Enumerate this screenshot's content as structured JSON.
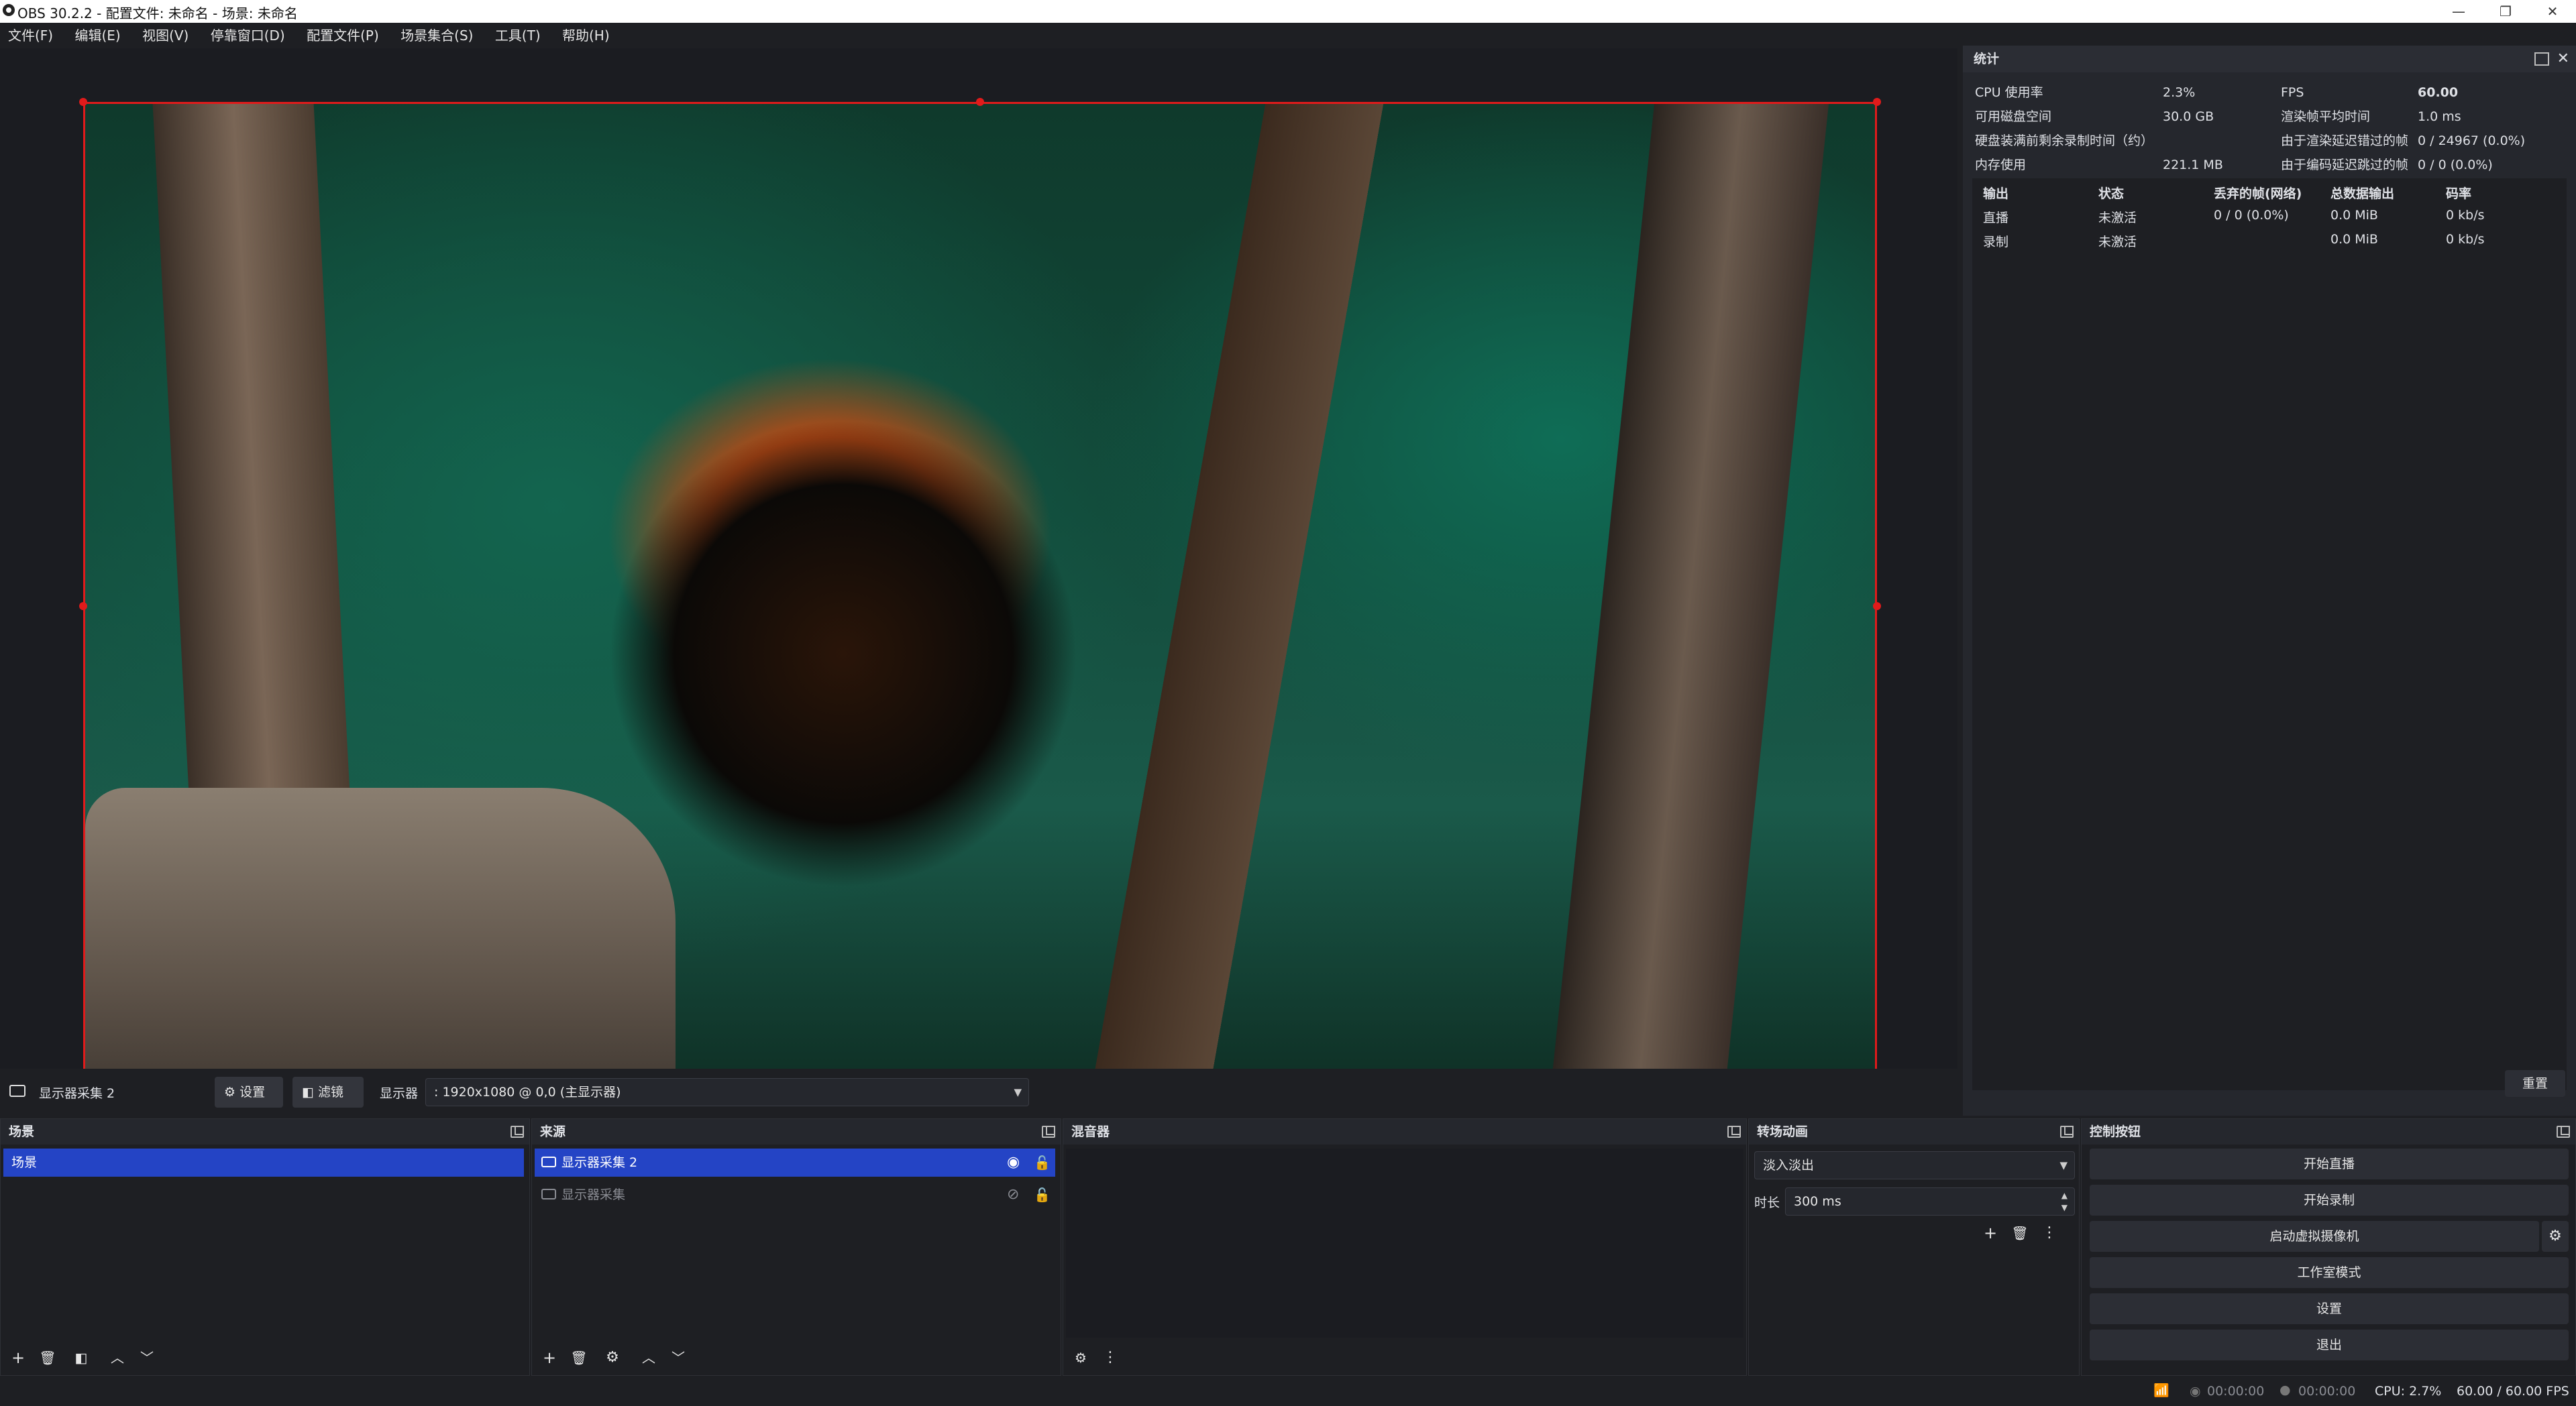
{
  "window": {
    "title": "OBS 30.2.2 - 配置文件: 未命名 - 场景: 未命名"
  },
  "menu": [
    "文件(F)",
    "编辑(E)",
    "视图(V)",
    "停靠窗口(D)",
    "配置文件(P)",
    "场景集合(S)",
    "工具(T)",
    "帮助(H)"
  ],
  "source_bar": {
    "source_name": "显示器采集 2",
    "settings_label": "设置",
    "filters_label": "滤镜",
    "display_label": "显示器",
    "display_value": ": 1920x1080 @ 0,0 (主显示器)"
  },
  "stats": {
    "title": "统计",
    "cpu_label": "CPU 使用率",
    "cpu_value": "2.3%",
    "disk_label": "可用磁盘空间",
    "disk_value": "30.0 GB",
    "disk_full_label": "硬盘装满前剩余录制时间（约）",
    "mem_label": "内存使用",
    "mem_value": "221.1 MB",
    "fps_label": "FPS",
    "fps_value": "60.00",
    "render_avg_label": "渲染帧平均时间",
    "render_avg_value": "1.0 ms",
    "render_lag_label": "由于渲染延迟错过的帧",
    "render_lag_value": "0 / 24967 (0.0%)",
    "encode_lag_label": "由于编码延迟跳过的帧",
    "encode_lag_value": "0 / 0 (0.0%)",
    "columns": [
      "输出",
      "状态",
      "丢弃的帧(网络)",
      "总数据输出",
      "码率"
    ],
    "rows": [
      [
        "直播",
        "未激活",
        "0 / 0 (0.0%)",
        "0.0 MiB",
        "0 kb/s"
      ],
      [
        "录制",
        "未激活",
        "",
        "0.0 MiB",
        "0 kb/s"
      ]
    ],
    "reset_label": "重置"
  },
  "docks": {
    "scenes": {
      "title": "场景",
      "items": [
        "场景"
      ]
    },
    "sources": {
      "title": "来源",
      "items": [
        "显示器采集 2",
        "显示器采集"
      ]
    },
    "mixer": {
      "title": "混音器"
    },
    "transitions": {
      "title": "转场动画",
      "transition": "淡入淡出",
      "duration_label": "时长",
      "duration_value": "300 ms"
    },
    "controls": {
      "title": "控制按钮",
      "buttons": [
        "开始直播",
        "开始录制",
        "启动虚拟摄像机",
        "工作室模式",
        "设置",
        "退出"
      ]
    }
  },
  "status": {
    "stream_time": "00:00:00",
    "rec_time": "00:00:00",
    "cpu": "CPU: 2.7%",
    "fps": "60.00 / 60.00 FPS"
  },
  "colors": {
    "accent": "#2444c5",
    "selection_border": "#e01b1b"
  }
}
